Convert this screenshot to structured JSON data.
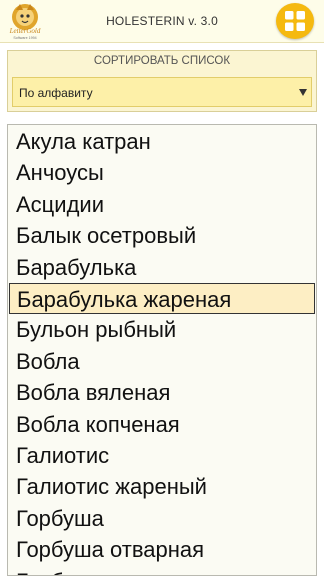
{
  "header": {
    "title": "HOLESTERIN v. 3.0",
    "logo_text": "LetterGold",
    "logo_subtext": "Software 1994",
    "menu_icon": "grid-icon",
    "accent_color": "#f5b90f"
  },
  "sort": {
    "label": "СОРТИРОВАТЬ СПИСОК",
    "selected_option": "По алфавиту"
  },
  "list": {
    "selected_index": 5,
    "items": [
      "Акула катран",
      "Анчоусы",
      "Асцидии",
      "Балык осетровый",
      "Барабулька",
      "Барабулька жареная",
      "Бульон рыбный",
      "Вобла",
      "Вобла вяленая",
      "Вобла копченая",
      "Галиотис",
      "Галиотис жареный",
      "Горбуша",
      "Горбуша отварная",
      "Горбуша соленая"
    ]
  }
}
